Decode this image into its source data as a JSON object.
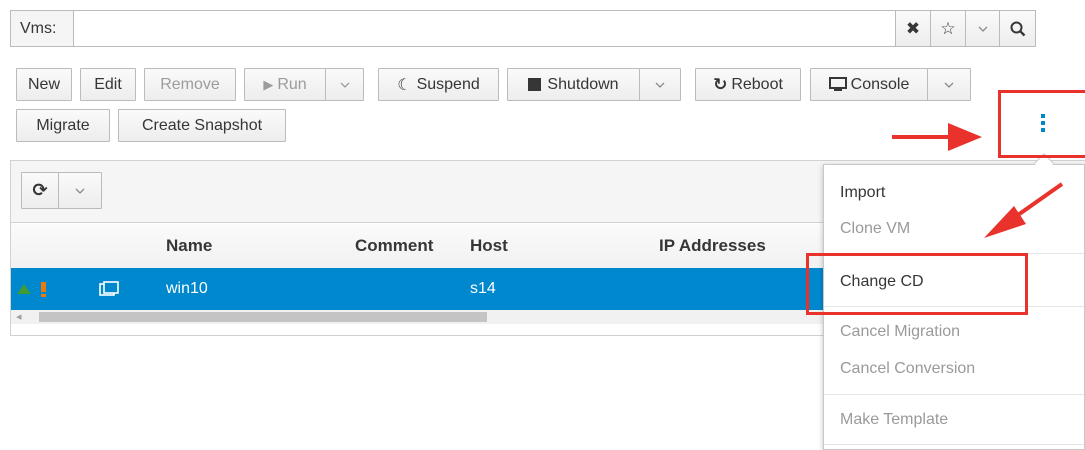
{
  "search": {
    "label": "Vms:",
    "value": "",
    "placeholder": ""
  },
  "toolbar": {
    "new": "New",
    "edit": "Edit",
    "remove": "Remove",
    "run": "Run",
    "suspend": "Suspend",
    "shutdown": "Shutdown",
    "reboot": "Reboot",
    "console": "Console",
    "migrate": "Migrate",
    "create_snapshot": "Create Snapshot"
  },
  "grid": {
    "columns": [
      "",
      "",
      "Name",
      "Comment",
      "Host",
      "IP Addresses"
    ],
    "rows": [
      {
        "name": "win10",
        "comment": "",
        "host": "s14",
        "ip": ""
      }
    ]
  },
  "kebab_menu": {
    "items": [
      {
        "label": "Import",
        "enabled": true
      },
      {
        "label": "Clone VM",
        "enabled": false
      },
      {
        "label": "Change CD",
        "enabled": true
      },
      {
        "label": "Cancel Migration",
        "enabled": false
      },
      {
        "label": "Cancel Conversion",
        "enabled": false
      },
      {
        "label": "Make Template",
        "enabled": false
      }
    ]
  },
  "colors": {
    "selection": "#0088ce",
    "annotation": "#e8322b",
    "kebab": "#0088ce"
  },
  "icons": [
    "clear-icon",
    "bookmark-star-icon",
    "chevron-down-icon",
    "search-icon",
    "play-icon",
    "moon-icon",
    "stop-icon",
    "reboot-icon",
    "monitor-icon",
    "kebab-icon",
    "refresh-icon",
    "status-up-icon",
    "warning-icon",
    "vm-type-icon"
  ]
}
